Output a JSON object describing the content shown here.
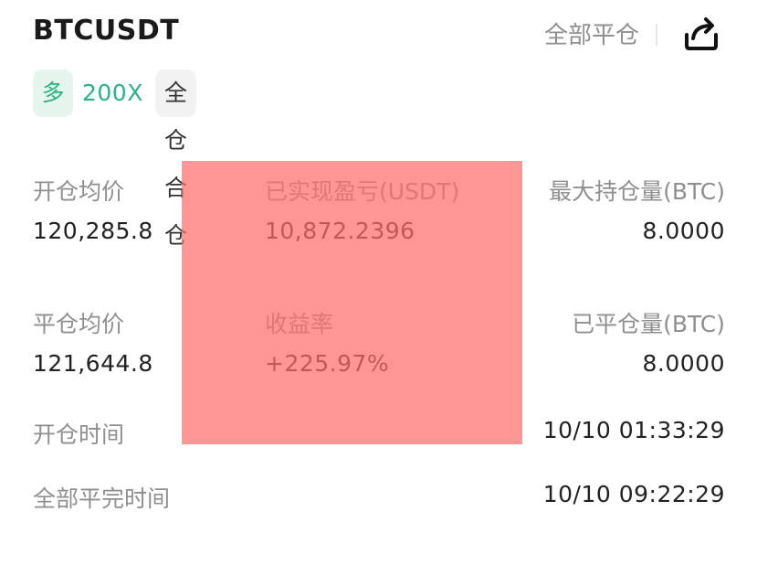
{
  "header": {
    "symbol": "BTCUSDT",
    "close_all_label": "全部平仓"
  },
  "icons": {
    "share": "share-icon"
  },
  "tags": {
    "direction": "多",
    "leverage": "200X",
    "margin_mode": "全仓 合仓"
  },
  "stats": {
    "open_avg_price": {
      "label": "开仓均价",
      "value": "120,285.8"
    },
    "realized_pnl": {
      "label": "已实现盈亏(USDT)",
      "value": "10,872.2396"
    },
    "max_position": {
      "label": "最大持仓量(BTC)",
      "value": "8.0000"
    },
    "close_avg_price": {
      "label": "平仓均价",
      "value": "121,644.8"
    },
    "roi": {
      "label": "收益率",
      "value": "+225.97%"
    },
    "closed_volume": {
      "label": "已平仓量(BTC)",
      "value": "8.0000"
    },
    "open_time": {
      "label": "开仓时间",
      "value": "10/10 01:33:29"
    },
    "close_time": {
      "label": "全部平完时间",
      "value": "10/10 09:22:29"
    }
  },
  "colors": {
    "long_green": "#2bb382",
    "label_gray": "#8f8f8f",
    "redaction_red": "#ff8a8a"
  }
}
